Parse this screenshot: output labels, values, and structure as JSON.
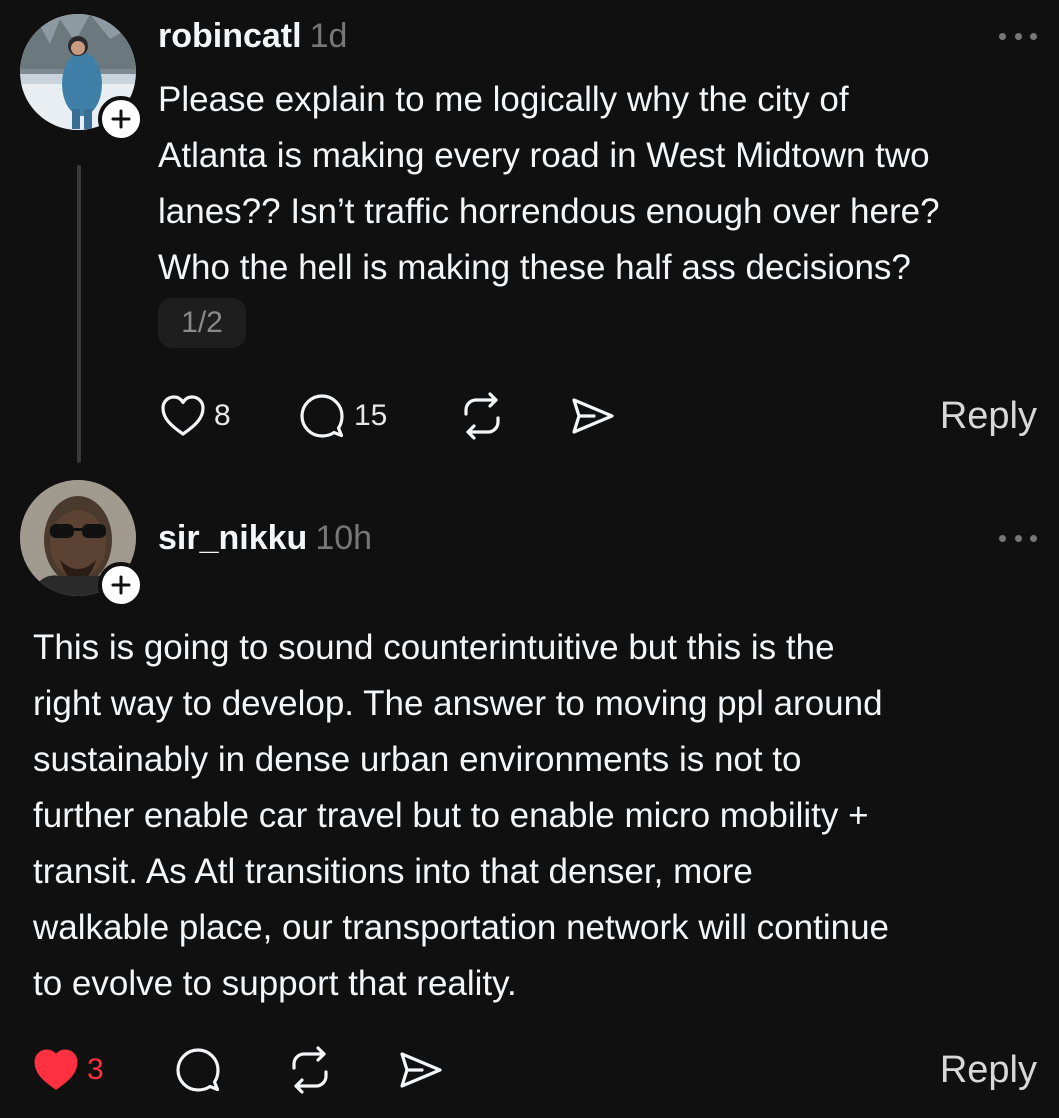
{
  "post1": {
    "username": "robincatl",
    "time": "1d",
    "text_lines": [
      "Please explain to me logically why the city of",
      "Atlanta is making every road in West Midtown two",
      "lanes?? Isn’t traffic horrendous enough over here?",
      "Who the hell is making these half ass decisions?"
    ],
    "page_indicator": "1/2",
    "likes": "8",
    "comments": "15",
    "reply_label": "Reply",
    "like_active": false
  },
  "post2": {
    "username": "sir_nikku",
    "time": "10h",
    "text_lines": [
      "This is going to sound counterintuitive but this is the",
      "right way to develop. The answer to moving ppl around",
      "sustainably in dense urban environments is not to",
      "further enable car travel but to enable micro mobility +",
      "transit. As Atl transitions into that denser, more",
      "walkable place, our transportation network will continue",
      "to evolve to support that reality."
    ],
    "likes": "3",
    "reply_label": "Reply",
    "like_active": true
  },
  "icons": {
    "like": "heart-icon",
    "comment": "comment-bubble-icon",
    "repost": "repost-icon",
    "share": "send-icon",
    "more": "more-dots-icon",
    "follow": "plus-icon"
  },
  "colors": {
    "background": "#101010",
    "text": "#f3f5f7",
    "muted": "#777777",
    "like_active": "#ff3040"
  }
}
